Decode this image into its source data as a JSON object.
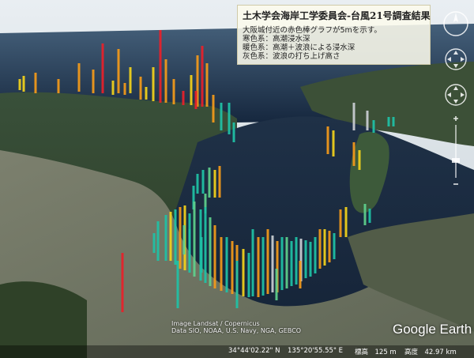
{
  "legend": {
    "title": "土木学会海岸工学委員会-台風21号調査結果",
    "lines": [
      "大阪城付近の赤色棒グラフが5mを示す。",
      "寒色系：高潮浸水深",
      "暖色系：高潮＋波浪による浸水深",
      "灰色系：波浪の打ち上げ高さ"
    ]
  },
  "attribution": [
    "Image Landsat / Copernicus",
    "Data SIO, NOAA, U.S. Navy, NGA, GEBCO"
  ],
  "logo": "Google Earth",
  "status": {
    "latitude": "34°44'02.22\" N",
    "longitude": "135°20'55.55\" E",
    "elevation": "標高　125 m",
    "altitude": "高度　42.97 km"
  },
  "colors": {
    "red": "#e8202a",
    "orange": "#f39a1a",
    "yellow": "#f2d21b",
    "cyan": "#1fc2a6",
    "green": "#5fd08c",
    "gray": "#c9cdd2"
  },
  "icons": [
    "compass-icon",
    "look-joystick-icon",
    "move-joystick-icon",
    "zoom-in-icon",
    "zoom-out-icon"
  ]
}
